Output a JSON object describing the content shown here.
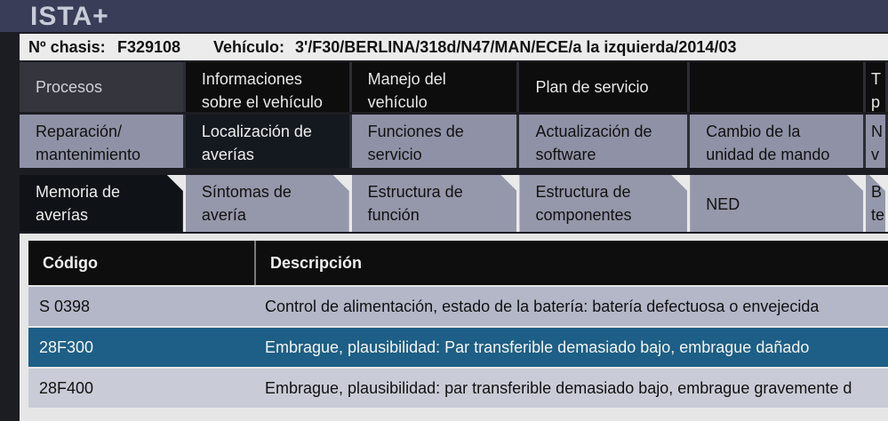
{
  "app": {
    "title": "ISTA+"
  },
  "vehicle_info": {
    "chassis_label": "Nº chasis:",
    "chassis_value": "F329108",
    "vehicle_label": "Vehículo:",
    "vehicle_value": "3'/F30/BERLINA/318d/N47/MAN/ECE/a la izquierda/2014/03"
  },
  "main_tabs": [
    {
      "label": "Procesos"
    },
    {
      "label": "Informaciones\nsobre el vehículo"
    },
    {
      "label": "Manejo del\nvehículo"
    },
    {
      "label": "Plan de servicio"
    },
    {
      "label": ""
    },
    {
      "label": "T\np"
    }
  ],
  "sub_tabs": [
    {
      "label": "Reparación/\nmantenimiento"
    },
    {
      "label": "Localización de\naverías"
    },
    {
      "label": "Funciones de\nservicio"
    },
    {
      "label": "Actualización de\nsoftware"
    },
    {
      "label": "Cambio de la\nunidad de mando"
    },
    {
      "label": "N\nv"
    }
  ],
  "diag_tabs": [
    {
      "label": "Memoria de\naverías"
    },
    {
      "label": "Síntomas de\navería"
    },
    {
      "label": "Estructura de\nfunción"
    },
    {
      "label": "Estructura de\ncomponentes"
    },
    {
      "label": "NED"
    },
    {
      "label": "B\nte"
    }
  ],
  "fault_table": {
    "columns": [
      "Código",
      "Descripción"
    ],
    "rows": [
      {
        "code": "S 0398",
        "description": "Control de alimentación, estado de la batería: batería defectuosa o envejecida"
      },
      {
        "code": "28F300",
        "description": "Embrague, plausibilidad: Par transferible demasiado bajo, embrague dañado"
      },
      {
        "code": "28F400",
        "description": "Embrague, plausibilidad: par transferible demasiado bajo, embrague gravemente d"
      }
    ]
  },
  "colors": {
    "selected_row": "#1d5f86",
    "row_light": "#b3b7c8",
    "tab_active": "#0f1318",
    "tab_inactive": "#9598aa"
  }
}
